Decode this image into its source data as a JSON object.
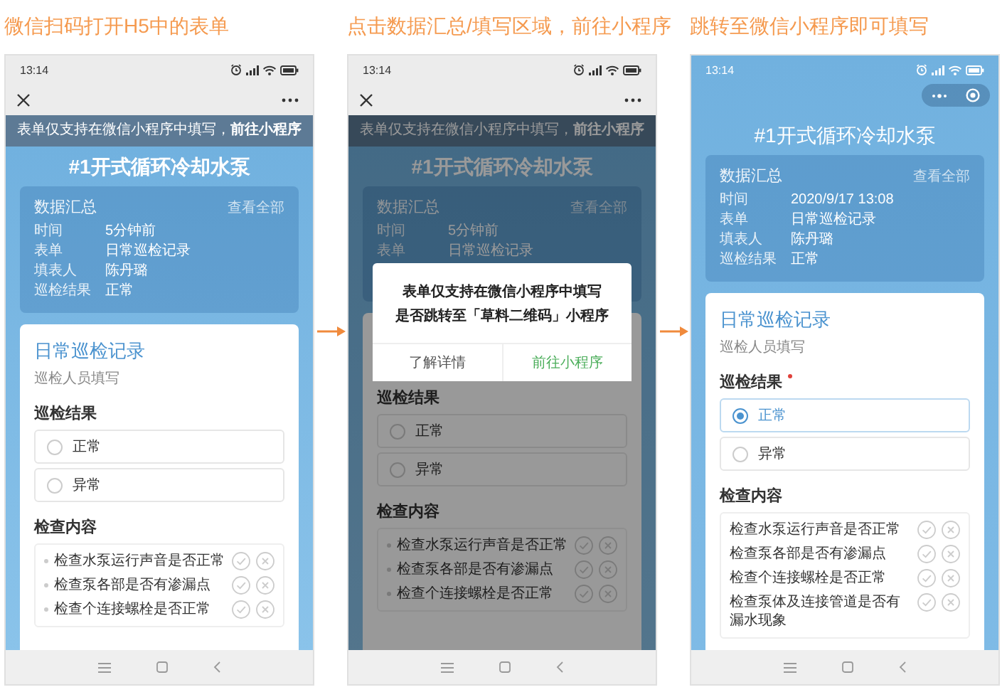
{
  "phones": [
    {
      "caption": "微信扫码打开H5中的表单",
      "time": "13:14",
      "kind": "browser",
      "dimmed": false,
      "banner": "表单仅支持在微信小程序中填写，**前往小程序**",
      "title": "#1开式循环冷却水泵",
      "title_bold": true,
      "summary": {
        "heading": "数据汇总",
        "link": "查看全部",
        "rows": [
          {
            "label": "时间",
            "value": "5分钟前"
          },
          {
            "label": "表单",
            "value": "日常巡检记录"
          },
          {
            "label": "填表人",
            "value": "陈丹璐"
          },
          {
            "label": "巡检结果",
            "value": "正常"
          }
        ]
      },
      "form": {
        "title": "日常巡检记录",
        "subtitle": "巡检人员填写",
        "question": "巡检结果",
        "required": false,
        "options": [
          {
            "label": "正常",
            "selected": false
          },
          {
            "label": "异常",
            "selected": false
          }
        ],
        "section": "检查内容",
        "bulleted": true,
        "checks": [
          "检查水泵运行声音是否正常",
          "检查泵各部是否有渗漏点",
          "检查个连接螺栓是否正常"
        ]
      }
    },
    {
      "caption": "点击数据汇总/填写区域，前往小程序",
      "time": "13:14",
      "kind": "browser",
      "dimmed": true,
      "banner": "表单仅支持在微信小程序中填写，**前往小程序**",
      "title": "#1开式循环冷却水泵",
      "title_bold": true,
      "summary": {
        "heading": "数据汇总",
        "link": "查看全部",
        "rows": [
          {
            "label": "时间",
            "value": "5分钟前"
          },
          {
            "label": "表单",
            "value": "日常巡检记录"
          }
        ]
      },
      "form": {
        "question": "巡检结果",
        "required": false,
        "options": [
          {
            "label": "正常",
            "selected": false
          },
          {
            "label": "异常",
            "selected": false
          }
        ],
        "section": "检查内容",
        "bulleted": true,
        "checks": [
          "检查水泵运行声音是否正常",
          "检查泵各部是否有渗漏点",
          "检查个连接螺栓是否正常"
        ]
      },
      "dialog": {
        "lines": [
          "表单仅支持在微信小程序中填写",
          "是否跳转至「草料二维码」小程序"
        ],
        "buttons": [
          {
            "label": "了解详情",
            "primary": false
          },
          {
            "label": "前往小程序",
            "primary": true
          }
        ]
      }
    },
    {
      "caption": "跳转至微信小程序即可填写",
      "time": "13:14",
      "kind": "capsule",
      "dimmed": false,
      "title": "#1开式循环冷却水泵",
      "title_bold": false,
      "summary": {
        "heading": "数据汇总",
        "link": "查看全部",
        "rows": [
          {
            "label": "时间",
            "value": "2020/9/17 13:08"
          },
          {
            "label": "表单",
            "value": "日常巡检记录"
          },
          {
            "label": "填表人",
            "value": "陈丹璐"
          },
          {
            "label": "巡检结果",
            "value": "正常"
          }
        ]
      },
      "form": {
        "title": "日常巡检记录",
        "subtitle": "巡检人员填写",
        "question": "巡检结果",
        "required": true,
        "options": [
          {
            "label": "正常",
            "selected": true
          },
          {
            "label": "异常",
            "selected": false
          }
        ],
        "section": "检查内容",
        "bulleted": false,
        "checks": [
          "检查水泵运行声音是否正常",
          "检查泵各部是否有渗漏点",
          "检查个连接螺栓是否正常",
          "检查泵体及连接管道是否有漏水现象"
        ]
      }
    }
  ]
}
